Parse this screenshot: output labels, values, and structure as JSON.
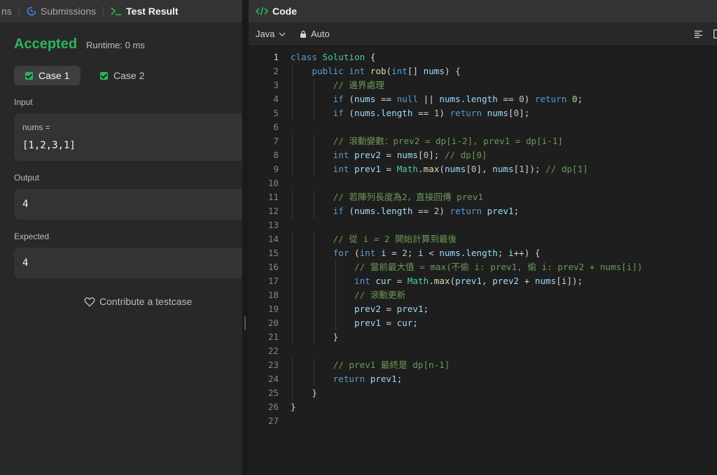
{
  "left_panel": {
    "tabs": [
      {
        "label": "ns"
      },
      {
        "label": "Submissions"
      },
      {
        "label": "Test Result"
      }
    ],
    "status": "Accepted",
    "runtime": "Runtime: 0 ms",
    "cases": [
      {
        "label": "Case 1",
        "passed": true,
        "active": true
      },
      {
        "label": "Case 2",
        "passed": true,
        "active": false
      }
    ],
    "input": {
      "label": "Input",
      "var_name": "nums =",
      "value": "[1,2,3,1]"
    },
    "output": {
      "label": "Output",
      "value": "4"
    },
    "expected": {
      "label": "Expected",
      "value": "4"
    },
    "contribute_label": "Contribute a testcase"
  },
  "code_panel": {
    "title": "Code",
    "language": "Java",
    "mode": "Auto",
    "lines": [
      "class Solution {",
      "    public int rob(int[] nums) {",
      "        // 邊界處理",
      "        if (nums == null || nums.length == 0) return 0;",
      "        if (nums.length == 1) return nums[0];",
      "",
      "        // 滾動變數：prev2 = dp[i-2], prev1 = dp[i-1]",
      "        int prev2 = nums[0]; // dp[0]",
      "        int prev1 = Math.max(nums[0], nums[1]); // dp[1]",
      "",
      "        // 若陣列長度為2，直接回傳 prev1",
      "        if (nums.length == 2) return prev1;",
      "",
      "        // 從 i = 2 開始計算到最後",
      "        for (int i = 2; i < nums.length; i++) {",
      "            // 當前最大值 = max(不偷 i: prev1, 偷 i: prev2 + nums[i])",
      "            int cur = Math.max(prev1, prev2 + nums[i]);",
      "            // 滾動更新",
      "            prev2 = prev1;",
      "            prev1 = cur;",
      "        }",
      "",
      "        // prev1 最終是 dp[n-1]",
      "        return prev1;",
      "    }",
      "}",
      ""
    ]
  },
  "colors": {
    "accepted": "#2db55d",
    "keyword": "#569cd6",
    "comment": "#6a9955",
    "number": "#b5cea8",
    "function": "#dcdcaa",
    "variable": "#9cdcfe"
  }
}
